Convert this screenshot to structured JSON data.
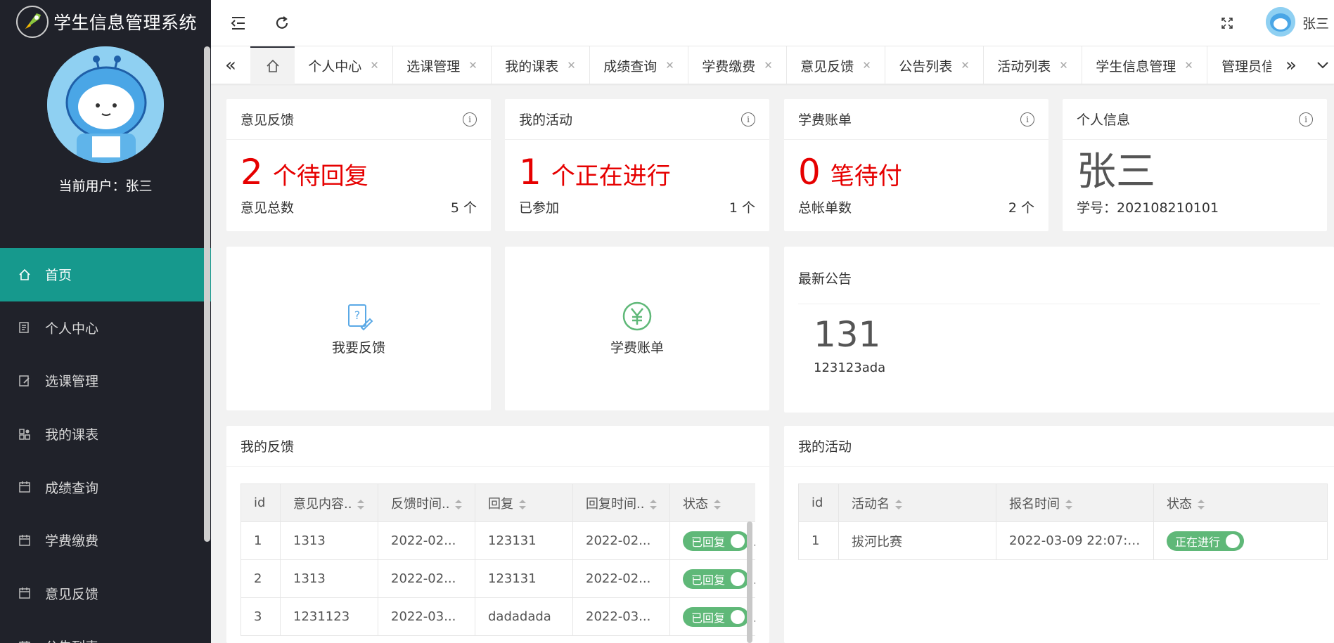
{
  "app": {
    "title": "学生信息管理系统"
  },
  "sidebar": {
    "current_user": "当前用户：张三",
    "items": [
      {
        "label": "首页",
        "icon": "home-icon",
        "active": true
      },
      {
        "label": "个人中心",
        "icon": "profile-icon"
      },
      {
        "label": "选课管理",
        "icon": "edit-icon"
      },
      {
        "label": "我的课表",
        "icon": "grid-icon"
      },
      {
        "label": "成绩查询",
        "icon": "calendar-icon"
      },
      {
        "label": "学费缴费",
        "icon": "calendar-icon"
      },
      {
        "label": "意见反馈",
        "icon": "calendar-icon"
      },
      {
        "label": "公告列表",
        "icon": "calendar-icon"
      }
    ]
  },
  "header": {
    "user": "张三"
  },
  "tabs": [
    "个人中心",
    "选课管理",
    "我的课表",
    "成绩查询",
    "学费缴费",
    "意见反馈",
    "公告列表",
    "活动列表",
    "学生信息管理",
    "管理员信息"
  ],
  "cards": {
    "feedback": {
      "title": "意见反馈",
      "num": "2",
      "text": "个待回复",
      "foot_label": "意见总数",
      "foot_value": "5 个"
    },
    "activity": {
      "title": "我的活动",
      "num": "1",
      "text": "个正在进行",
      "foot_label": "已参加",
      "foot_value": "1 个"
    },
    "bill": {
      "title": "学费账单",
      "num": "0",
      "text": "笔待付",
      "foot_label": "总帐单数",
      "foot_value": "2 个"
    },
    "info": {
      "title": "个人信息",
      "name": "张三",
      "student_no": "学号：202108210101"
    }
  },
  "actions": {
    "feedback": "我要反馈",
    "bill": "学费账单"
  },
  "notice": {
    "title": "最新公告",
    "num": "131",
    "text": "123123ada"
  },
  "my_feedback": {
    "title": "我的反馈",
    "headers": [
      "id",
      "意见内容..",
      "反馈时间..",
      "回复",
      "回复时间..",
      "状态"
    ],
    "rows": [
      {
        "id": "1",
        "content": "1313",
        "time": "2022-02...",
        "reply": "123131",
        "reply_time": "2022-02...",
        "status": "已回复"
      },
      {
        "id": "2",
        "content": "1313",
        "time": "2022-02...",
        "reply": "123131",
        "reply_time": "2022-02...",
        "status": "已回复"
      },
      {
        "id": "3",
        "content": "1231123",
        "time": "2022-03...",
        "reply": "dadadada",
        "reply_time": "2022-03...",
        "status": "已回复"
      }
    ]
  },
  "my_activity": {
    "title": "我的活动",
    "headers": [
      "id",
      "活动名",
      "报名时间",
      "状态"
    ],
    "rows": [
      {
        "id": "1",
        "name": "拔河比赛",
        "time": "2022-03-09 22:07:05",
        "status": "正在进行"
      }
    ]
  },
  "colors": {
    "accent": "#16998d",
    "sidebar": "#20222a",
    "alert": "#e60000",
    "switch": "#5fb878"
  }
}
